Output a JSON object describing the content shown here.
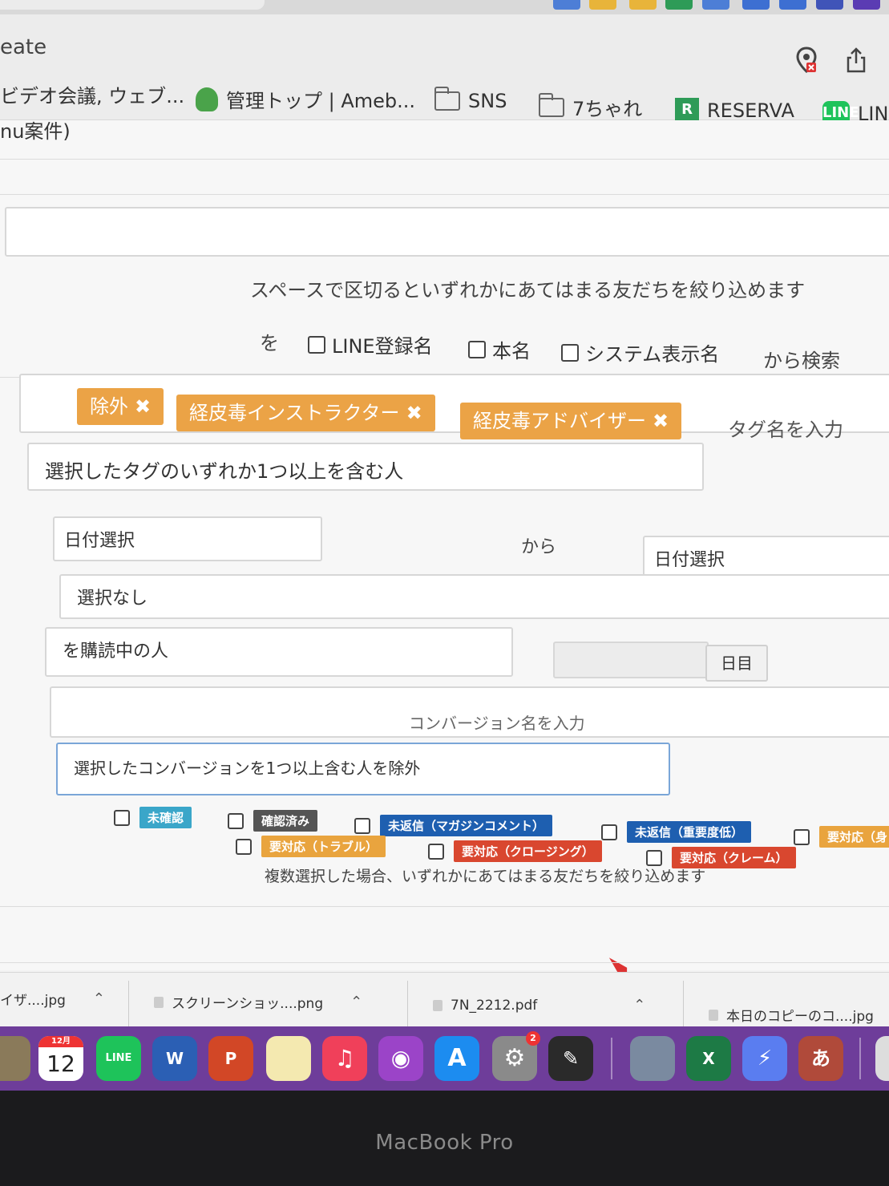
{
  "browser": {
    "address_text": "eate",
    "bookmarks": [
      "ビデオ会議, ウェブ...",
      "管理トップ | Ameb...",
      "SNS",
      "7ちゃれ",
      "RESERVA",
      "LIN"
    ]
  },
  "page": {
    "breadcrumb": "nu案件)",
    "search_hint": "スペースで区切るといずれかにあてはまる友だちを絞り込めます",
    "search_prefix": "を",
    "search_options": [
      "LINE登録名",
      "本名",
      "システム表示名"
    ],
    "search_suffix": "から検索",
    "tags": [
      "除外",
      "経皮毒インストラクター",
      "経皮毒アドバイザー"
    ],
    "tag_input_placeholder": "タグ名を入力",
    "tag_condition": "選択したタグのいずれか1つ以上を含む人",
    "date_from_placeholder": "日付選択",
    "date_between": "から",
    "date_to_placeholder": "日付選択",
    "select_none": "選択なし",
    "subscribing": "を購読中の人",
    "day_unit": "日目",
    "conversion_placeholder": "コンバージョン名を入力",
    "conversion_condition": "選択したコンバージョンを1つ以上含む人を除外",
    "statuses": [
      {
        "label": "未確認",
        "color": "#3aa6c9"
      },
      {
        "label": "確認済み",
        "color": "#555555"
      },
      {
        "label": "未返信（マガジンコメント）",
        "color": "#1e5fb0"
      },
      {
        "label": "未返信（重要度低）",
        "color": "#1e5fb0"
      },
      {
        "label": "要対応（身",
        "color": "#e9a43e"
      },
      {
        "label": "要対応（トラブル）",
        "color": "#e9a43e"
      },
      {
        "label": "要対応（クロージング）",
        "color": "#d9472f"
      },
      {
        "label": "要対応（クレーム）",
        "color": "#d9472f"
      }
    ],
    "status_hint": "複数選択した場合、いずれかにあてはまる友だちを絞り込めます"
  },
  "downloads": [
    "イザ....jpg",
    "スクリーンショッ....png",
    "7N_2212.pdf",
    "本日のコピーのコ....jpg"
  ],
  "dock": {
    "calendar_month": "12月",
    "calendar_day": "12",
    "line_label": "LINE",
    "word_label": "W",
    "powerpoint_label": "P",
    "excel_label": "X",
    "ime_label": "あ",
    "settings_badge": "2"
  },
  "device_label": "MacBook Pro"
}
